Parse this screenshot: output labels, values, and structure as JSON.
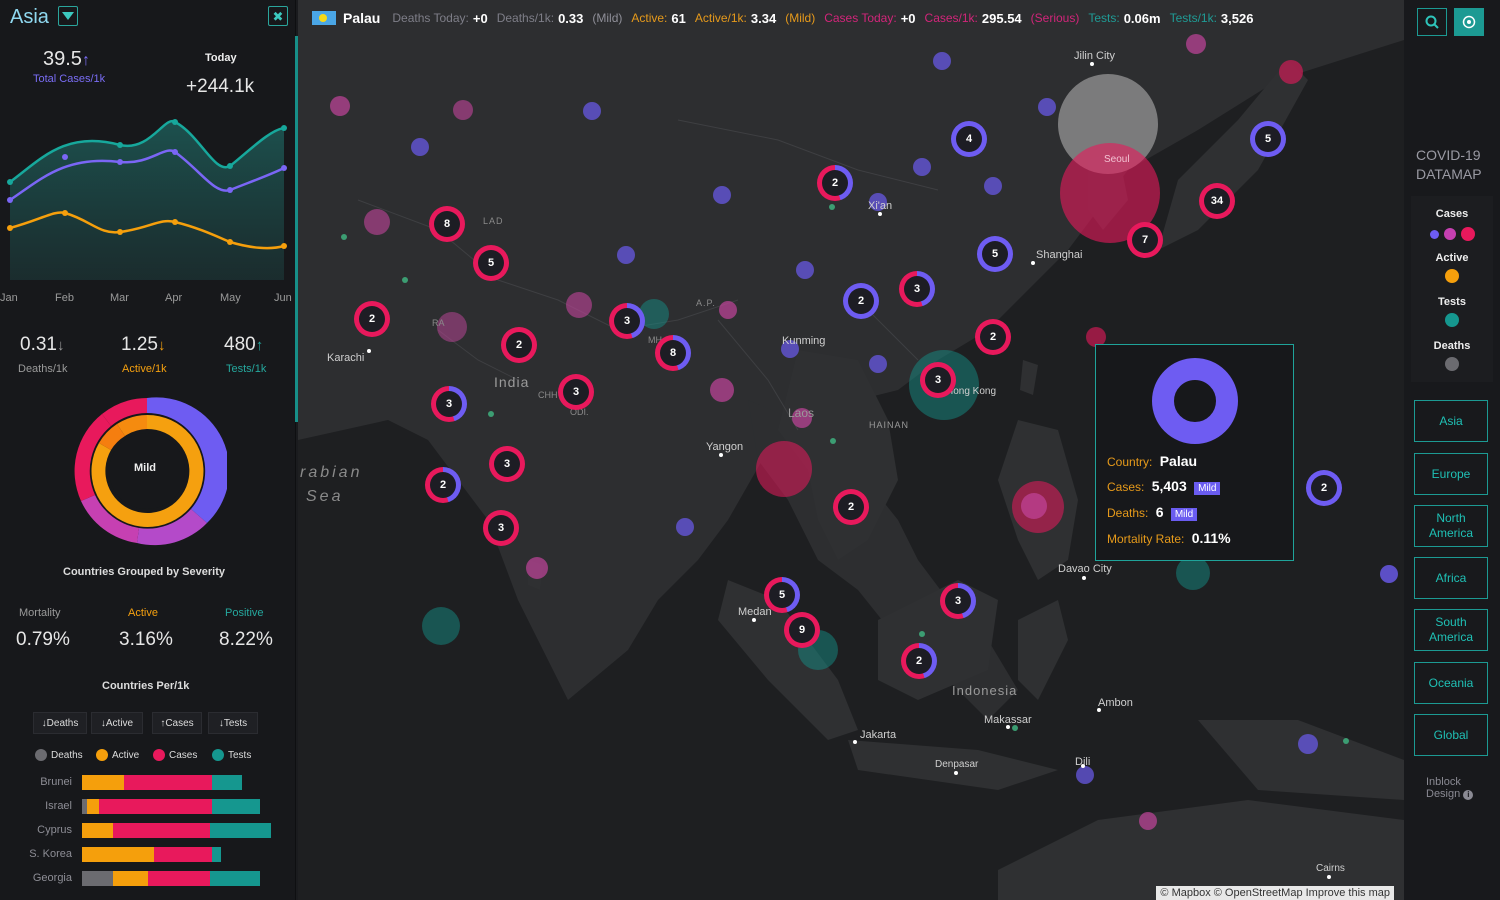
{
  "region": "Asia",
  "left": {
    "total_cases_per_1k": "39.5",
    "total_cases_label": "Total Cases/1k",
    "today_label": "Today",
    "today_value": "+244.1k",
    "months": [
      "Jan",
      "Feb",
      "Mar",
      "Apr",
      "May",
      "Jun"
    ],
    "deaths_per_1k": "0.31",
    "deaths_per_1k_label": "Deaths/1k",
    "active_per_1k": "1.25",
    "active_per_1k_label": "Active/1k",
    "tests_per_1k": "480",
    "tests_per_1k_label": "Tests/1k",
    "donut_center": "Mild",
    "donut_caption": "Countries Grouped by Severity",
    "mortality_label": "Mortality",
    "mortality_value": "0.79%",
    "active_label": "Active",
    "active_value": "3.16%",
    "positive_label": "Positive",
    "positive_value": "8.22%",
    "per1k_title": "Countries Per/1k",
    "sort_buttons": [
      "Deaths",
      "Active",
      "Cases",
      "Tests"
    ],
    "legend": [
      "Deaths",
      "Active",
      "Cases",
      "Tests"
    ],
    "countries": [
      {
        "name": "Brunei",
        "deaths": 0,
        "active": 42,
        "cases": 88,
        "tests": 30
      },
      {
        "name": "Israel",
        "deaths": 5,
        "active": 12,
        "cases": 113,
        "tests": 48
      },
      {
        "name": "Cyprus",
        "deaths": 0,
        "active": 31,
        "cases": 97,
        "tests": 61
      },
      {
        "name": "S. Korea",
        "deaths": 0,
        "active": 72,
        "cases": 58,
        "tests": 9
      },
      {
        "name": "Georgia",
        "deaths": 31,
        "active": 35,
        "cases": 62,
        "tests": 50
      }
    ]
  },
  "topbar": {
    "country": "Palau",
    "deaths_today_label": "Deaths Today:",
    "deaths_today": "+0",
    "deaths_1k_label": "Deaths/1k:",
    "deaths_1k": "0.33",
    "deaths_sev": "(Mild)",
    "active_label": "Active:",
    "active": "61",
    "active_1k_label": "Active/1k:",
    "active_1k": "3.34",
    "active_sev": "(Mild)",
    "cases_today_label": "Cases Today:",
    "cases_today": "+0",
    "cases_1k_label": "Cases/1k:",
    "cases_1k": "295.54",
    "cases_sev": "(Serious)",
    "tests_label": "Tests:",
    "tests": "0.06m",
    "tests_1k_label": "Tests/1k:",
    "tests_1k": "3,526"
  },
  "map_labels": {
    "jilin": "Jilin City",
    "seoul": "Seoul",
    "xian": "Xi'an",
    "shanghai": "Shanghai",
    "lad": "LAD",
    "ap": "A.P.",
    "kunming": "Kunming",
    "karachi": "Karachi",
    "india": "India",
    "raj": "RA",
    "chh": "CHH",
    "odi": "ODI.",
    "hong_kong": "Hong Kong",
    "laos": "Laos",
    "hainan": "HAINAN",
    "yangon": "Yangon",
    "arabian1": "rabian",
    "arabian2": "Sea",
    "davao": "Davao City",
    "medan": "Medan",
    "indonesia": "Indonesia",
    "ambon": "Ambon",
    "makassar": "Makassar",
    "jakarta": "Jakarta",
    "denpasar": "Denpasar",
    "dili": "Dili",
    "cairns": "Cairns",
    "mh": "MH"
  },
  "clusters": [
    "4",
    "2",
    "5",
    "34",
    "7",
    "5",
    "5",
    "8",
    "2",
    "2",
    "2",
    "3",
    "8",
    "3",
    "2",
    "3",
    "3",
    "3",
    "2",
    "3",
    "2",
    "3",
    "5",
    "9",
    "3",
    "2",
    "2"
  ],
  "tooltip": {
    "country_label": "Country:",
    "country": "Palau",
    "cases_label": "Cases:",
    "cases": "5,403",
    "cases_tag": "Mild",
    "deaths_label": "Deaths:",
    "deaths": "6",
    "deaths_tag": "Mild",
    "mortality_label": "Mortality Rate:",
    "mortality": "0.11%"
  },
  "right": {
    "title_line1": "COVID-19",
    "title_line2": "DATAMAP",
    "legend_cases": "Cases",
    "legend_active": "Active",
    "legend_tests": "Tests",
    "legend_deaths": "Deaths",
    "regions": [
      "Asia",
      "Europe",
      "North America",
      "Africa",
      "South America",
      "Oceania",
      "Global"
    ],
    "footer_line1": "Inblock",
    "footer_line2": "Design"
  },
  "attribution": "© Mapbox © OpenStreetMap  Improve this map",
  "colors": {
    "cases": "#e8195c",
    "active": "#f59f0c",
    "tests": "#15978f",
    "deaths": "#6b6b70",
    "purple": "#6e5cf2",
    "accent": "#1fa39a"
  }
}
